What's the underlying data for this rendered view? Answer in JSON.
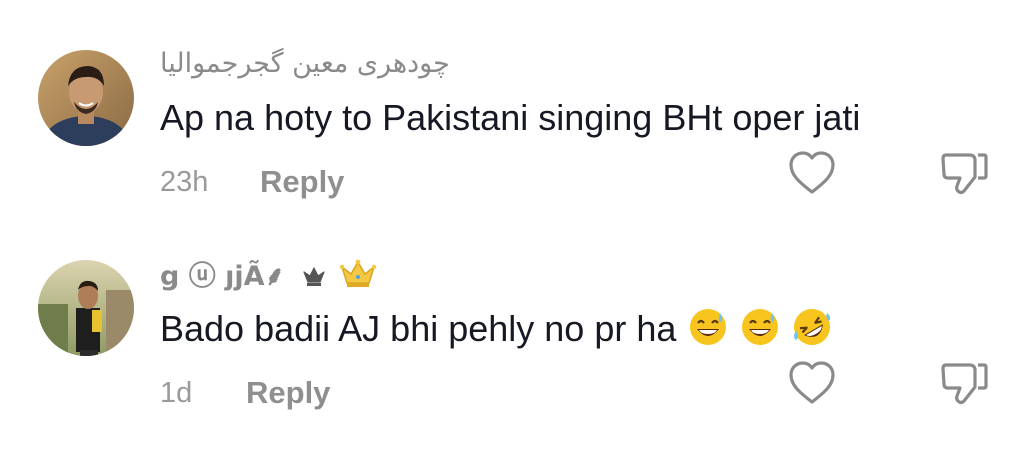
{
  "comments": [
    {
      "username": "چودھری معین گجرجموالیا",
      "text": "Ap na hoty to Pakistani singing BHt oper jati",
      "time": "23h",
      "reply_label": "Reply",
      "like_icon": "heart-icon",
      "dislike_icon": "thumbs-down-icon"
    },
    {
      "username": "g ⓤ ȷjÃ⸙",
      "username_emojis": [
        "crown-outline",
        "crown-gold"
      ],
      "text": "Bado badii AJ bhi pehly no pr ha",
      "text_emojis": [
        "sweat-smile",
        "sweat-smile",
        "rofl"
      ],
      "time": "1d",
      "reply_label": "Reply",
      "like_icon": "heart-icon",
      "dislike_icon": "thumbs-down-icon"
    }
  ],
  "colors": {
    "text_primary": "#161823",
    "text_secondary": "#8a8a8a",
    "icon": "#8a8a8a",
    "emoji_yellow": "#f7c51e"
  }
}
